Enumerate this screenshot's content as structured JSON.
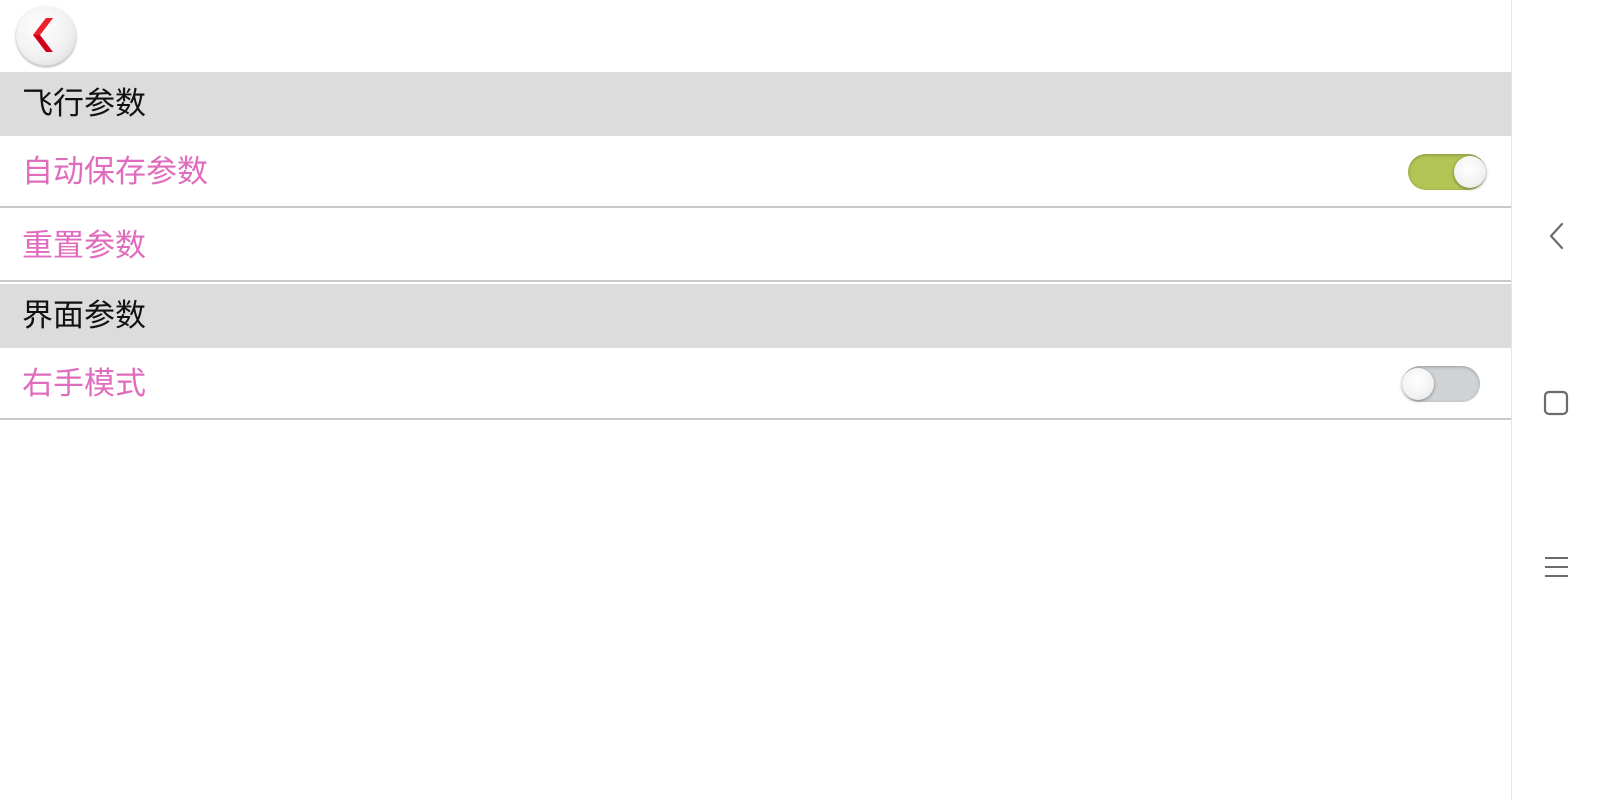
{
  "flight_section": {
    "title": "飞行参数",
    "auto_save": {
      "label": "自动保存参数",
      "enabled": true
    },
    "reset": {
      "label": "重置参数"
    }
  },
  "ui_section": {
    "title": "界面参数",
    "right_hand": {
      "label": "右手模式",
      "enabled": false
    }
  },
  "colors": {
    "setting_label": "#e06cbd",
    "section_bg": "#dcdcdc",
    "toggle_on": "#b1c454",
    "toggle_off": "#cfd3d6",
    "back_chevron": "#d0021b"
  },
  "icons": {
    "back": "chevron-left-icon",
    "nav_back": "nav-back-icon",
    "nav_home": "nav-home-icon",
    "nav_menu": "nav-menu-icon"
  }
}
